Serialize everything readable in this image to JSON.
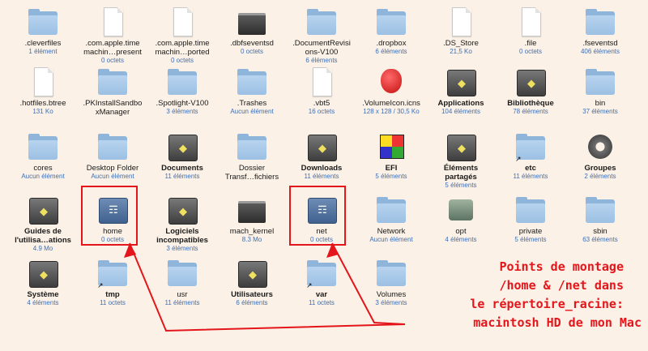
{
  "colors": {
    "background": "#fbf1e6",
    "annotation": "#e4151b",
    "subtitle": "#3d6fb6",
    "folder": "#9cc0e3"
  },
  "items": [
    {
      "name": ".cleverfiles",
      "sub": "1 élément",
      "icon": "folder-icon",
      "kind": "folder",
      "bold": false
    },
    {
      "name": ".com.apple.time\nmachin…present",
      "sub": "0 octets",
      "icon": "document-icon",
      "kind": "doc",
      "bold": false
    },
    {
      "name": ".com.apple.time\nmachin…ported",
      "sub": "0 octets",
      "icon": "document-icon",
      "kind": "doc",
      "bold": false
    },
    {
      "name": ".dbfseventsd",
      "sub": "0 octets",
      "icon": "terminal-icon",
      "kind": "term",
      "bold": false
    },
    {
      "name": ".DocumentRevisi\nons-V100",
      "sub": "6 éléments",
      "icon": "folder-icon",
      "kind": "folder",
      "bold": false
    },
    {
      "name": ".dropbox",
      "sub": "6 éléments",
      "icon": "folder-icon",
      "kind": "folder",
      "bold": false
    },
    {
      "name": ".DS_Store",
      "sub": "21,5 Ko",
      "icon": "document-icon",
      "kind": "doc",
      "bold": false
    },
    {
      "name": ".file",
      "sub": "0 octets",
      "icon": "document-icon",
      "kind": "doc",
      "bold": false
    },
    {
      "name": ".fseventsd",
      "sub": "406 éléments",
      "icon": "folder-icon",
      "kind": "folder",
      "bold": false
    },
    {
      "name": ".hotfiles.btree",
      "sub": "131 Ko",
      "icon": "document-icon",
      "kind": "doc",
      "bold": false
    },
    {
      "name": ".PKInstallSandbo\nxManager",
      "sub": "",
      "icon": "folder-icon",
      "kind": "folder",
      "bold": false
    },
    {
      "name": ".Spotlight-V100",
      "sub": "3 éléments",
      "icon": "folder-icon",
      "kind": "folder",
      "bold": false
    },
    {
      "name": ".Trashes",
      "sub": "Aucun élément",
      "icon": "folder-icon",
      "kind": "folder",
      "bold": false
    },
    {
      "name": ".vbt5",
      "sub": "16 octets",
      "icon": "document-icon",
      "kind": "doc",
      "bold": false
    },
    {
      "name": ".VolumeIcon.icns",
      "sub": "128 x 128 / 30,5 Ko",
      "icon": "apple-logo-icon",
      "kind": "apple",
      "bold": false
    },
    {
      "name": "Applications",
      "sub": "104 éléments",
      "icon": "applications-folder-icon",
      "kind": "dark",
      "bold": true
    },
    {
      "name": "Bibliothèque",
      "sub": "78 éléments",
      "icon": "library-folder-icon",
      "kind": "dark",
      "bold": true
    },
    {
      "name": "bin",
      "sub": "37 éléments",
      "icon": "folder-icon",
      "kind": "folder",
      "bold": false
    },
    {
      "name": "cores",
      "sub": "Aucun élément",
      "icon": "folder-icon",
      "kind": "folder",
      "bold": false
    },
    {
      "name": "Desktop Folder",
      "sub": "Aucun élément",
      "icon": "folder-icon",
      "kind": "folder",
      "bold": false
    },
    {
      "name": "Documents",
      "sub": "11 éléments",
      "icon": "documents-folder-icon",
      "kind": "dark",
      "bold": true
    },
    {
      "name": "Dossier\nTransf…fichiers",
      "sub": "",
      "icon": "folder-icon",
      "kind": "folder",
      "bold": false
    },
    {
      "name": "Downloads",
      "sub": "11 éléments",
      "icon": "downloads-folder-icon",
      "kind": "dark",
      "bold": true
    },
    {
      "name": "EFI",
      "sub": "5 éléments",
      "icon": "rubiks-cube-icon",
      "kind": "cube",
      "bold": true
    },
    {
      "name": "Éléments\npartagés",
      "sub": "5 éléments",
      "icon": "shared-folder-icon",
      "kind": "dark",
      "bold": true
    },
    {
      "name": "etc",
      "sub": "11 éléments",
      "icon": "folder-icon",
      "kind": "folder",
      "bold": true,
      "alias": true
    },
    {
      "name": "Groupes",
      "sub": "2 éléments",
      "icon": "gears-icon",
      "kind": "gears",
      "bold": true
    },
    {
      "name": "Guides de\nl'utilisa…ations",
      "sub": "4.9 Mo",
      "icon": "guides-folder-icon",
      "kind": "dark",
      "bold": true
    },
    {
      "name": "home",
      "sub": "0 octets",
      "icon": "network-disk-icon",
      "kind": "disk",
      "bold": false
    },
    {
      "name": "Logiciels\nincompatibles",
      "sub": "3 éléments",
      "icon": "incompatible-folder-icon",
      "kind": "dark",
      "bold": true
    },
    {
      "name": "mach_kernel",
      "sub": "8.3 Mo",
      "icon": "terminal-icon",
      "kind": "term",
      "bold": false
    },
    {
      "name": "net",
      "sub": "0 octets",
      "icon": "network-disk-icon",
      "kind": "disk",
      "bold": false
    },
    {
      "name": "Network",
      "sub": "Aucun élément",
      "icon": "folder-icon",
      "kind": "folder",
      "bold": false
    },
    {
      "name": "opt",
      "sub": "4 éléments",
      "icon": "network-dock-icon",
      "kind": "dock",
      "bold": false
    },
    {
      "name": "private",
      "sub": "5 éléments",
      "icon": "folder-icon",
      "kind": "folder",
      "bold": false
    },
    {
      "name": "sbin",
      "sub": "63 éléments",
      "icon": "folder-icon",
      "kind": "folder",
      "bold": false
    },
    {
      "name": "Système",
      "sub": "4 éléments",
      "icon": "system-folder-icon",
      "kind": "dark",
      "bold": true
    },
    {
      "name": "tmp",
      "sub": "11 octets",
      "icon": "folder-icon",
      "kind": "folder",
      "bold": true,
      "alias": true
    },
    {
      "name": "usr",
      "sub": "11 éléments",
      "icon": "folder-icon",
      "kind": "folder",
      "bold": false
    },
    {
      "name": "Utilisateurs",
      "sub": "6 éléments",
      "icon": "users-folder-icon",
      "kind": "dark",
      "bold": true
    },
    {
      "name": "var",
      "sub": "11 octets",
      "icon": "folder-icon",
      "kind": "folder",
      "bold": true,
      "alias": true
    },
    {
      "name": "Volumes",
      "sub": "3 éléments",
      "icon": "folder-icon",
      "kind": "folder",
      "bold": false
    }
  ],
  "annotation": {
    "lines": [
      "Points de montage",
      "/home & /net dans",
      "le répertoire_racine:",
      "macintosh HD de mon Mac"
    ]
  }
}
